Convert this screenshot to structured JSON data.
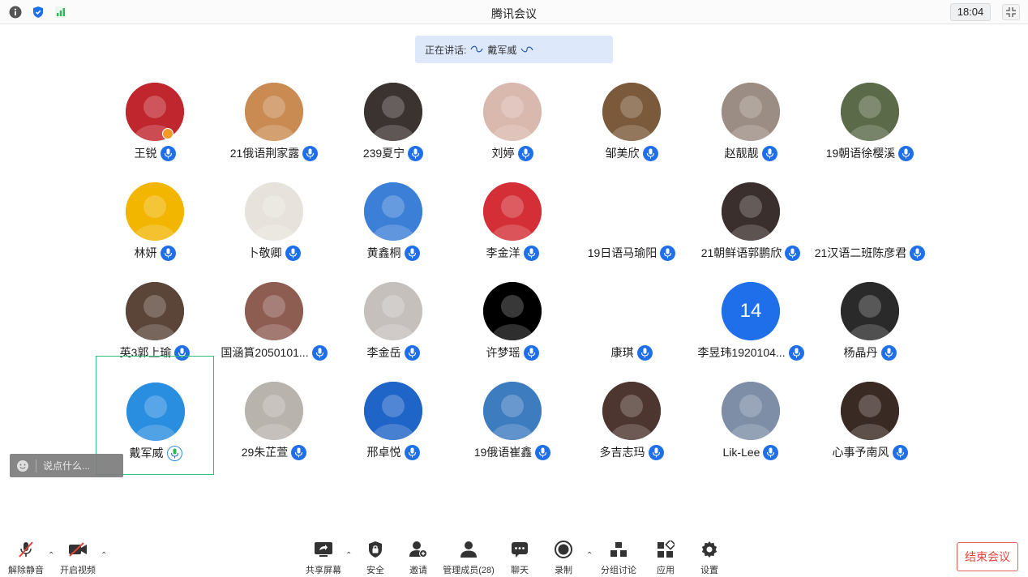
{
  "window": {
    "title": "腾讯会议",
    "time": "18:04"
  },
  "speaking": {
    "prefix": "正在讲话:",
    "name": "戴军威"
  },
  "participants": [
    {
      "name": "王锐",
      "bg": "#c0262e"
    },
    {
      "name": "21俄语荆家露",
      "bg": "#c98b52"
    },
    {
      "name": "239夏宁",
      "bg": "#3b3330"
    },
    {
      "name": "刘婷",
      "bg": "#d9b8ad"
    },
    {
      "name": "邹美欣",
      "bg": "#7a5a3a"
    },
    {
      "name": "赵靓靓",
      "bg": "#9b8d83"
    },
    {
      "name": "19朝语徐樱溪",
      "bg": "#5b6a48"
    },
    {
      "name": "林妍",
      "bg": "#f2b500"
    },
    {
      "name": "卜敬卿",
      "bg": "#e7e3dc"
    },
    {
      "name": "黄鑫桐",
      "bg": "#3c7fd6"
    },
    {
      "name": "李金洋",
      "bg": "#d42f36"
    },
    {
      "name": "19日语马瑜阳",
      "bg": "#ffffff"
    },
    {
      "name": "21朝鲜语郭鹏欣",
      "bg": "#3a2f2c"
    },
    {
      "name": "21汉语二班陈彦君",
      "bg": "#ffffff"
    },
    {
      "name": "英3郭上瑜",
      "bg": "#5a4538"
    },
    {
      "name": "国涵篔2050101...",
      "bg": "#8e5d52"
    },
    {
      "name": "李金岳",
      "bg": "#c6c0bd"
    },
    {
      "name": "许梦瑶",
      "bg": "#000000"
    },
    {
      "name": "康琪",
      "bg": "#ffffff"
    },
    {
      "name": "李昱玮1920104...",
      "bg": "#1f6fea",
      "initials": "14"
    },
    {
      "name": "杨晶丹",
      "bg": "#2b2a2a"
    },
    {
      "name": "戴军威",
      "bg": "#2a8ee0"
    },
    {
      "name": "29朱芷萱",
      "bg": "#b9b3ae"
    },
    {
      "name": "邢卓悦",
      "bg": "#1f64c7"
    },
    {
      "name": "19俄语崔鑫",
      "bg": "#3e7cc0"
    },
    {
      "name": "多吉志玛",
      "bg": "#4e3630"
    },
    {
      "name": "Lik-Lee",
      "bg": "#7d8ea6"
    },
    {
      "name": "心事予南风",
      "bg": "#3a2a24"
    }
  ],
  "chat": {
    "placeholder": "说点什么..."
  },
  "toolbar": {
    "unmute": "解除静音",
    "video": "开启视频",
    "share": "共享屏幕",
    "security": "安全",
    "invite": "邀请",
    "members": "管理成员(28)",
    "chat": "聊天",
    "record": "录制",
    "breakout": "分组讨论",
    "apps": "应用",
    "settings": "设置",
    "end": "结束会议"
  },
  "colors": {
    "accent": "#1f6fea",
    "active_border": "#2fc17a",
    "end": "#e0463c"
  }
}
